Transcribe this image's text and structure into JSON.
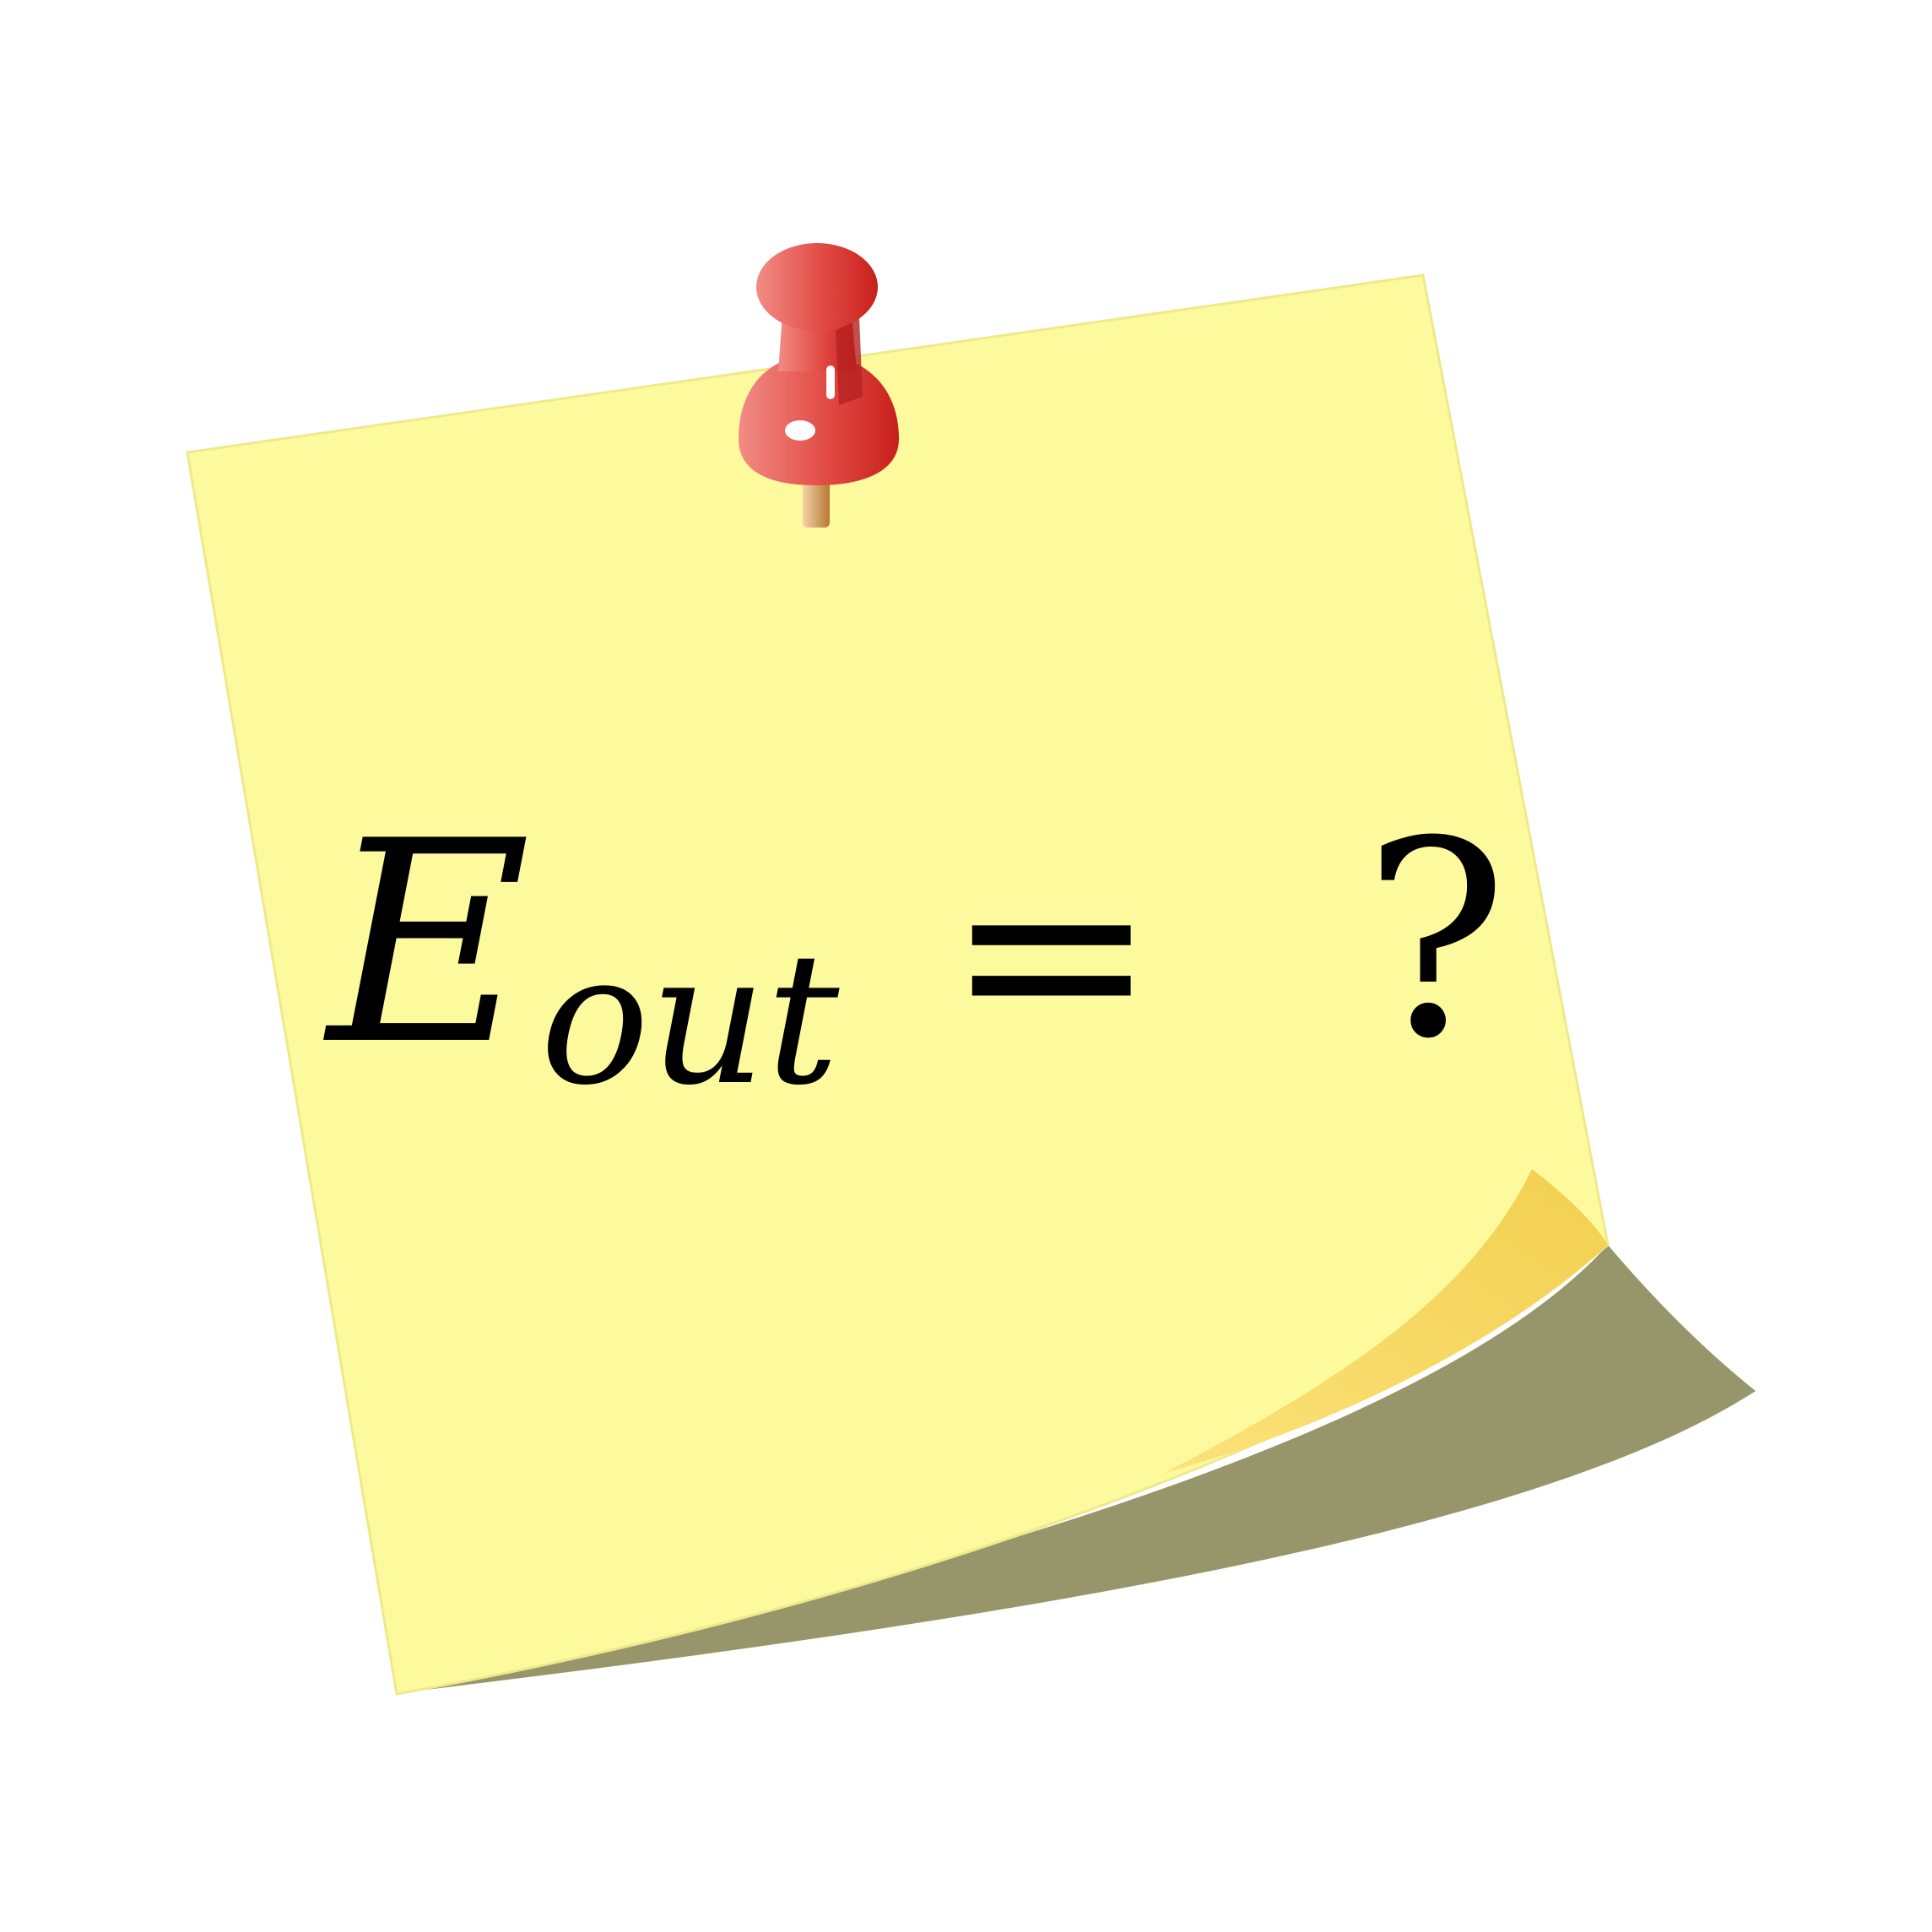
{
  "note": {
    "formula": {
      "variable": "E",
      "subscript": "out",
      "equals": "=",
      "value": "?"
    }
  },
  "colors": {
    "background": "#ffffff",
    "paper": "#fdfa9e",
    "paper_edge": "#efe98c",
    "curl": "#f4d354",
    "shadow": "#97966b",
    "pin_head": "#e0443f",
    "pin_highlight": "#f29b95",
    "pin_shade": "#b52220",
    "pin_needle": "#c98b45",
    "ink": "#000000"
  },
  "icons": {
    "pushpin": "pushpin-icon",
    "sticky_note": "sticky-note"
  }
}
